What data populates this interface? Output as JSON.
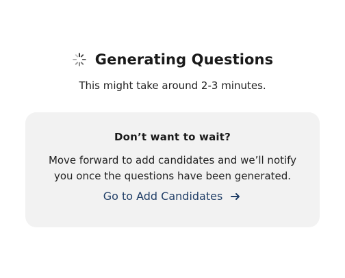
{
  "header": {
    "title": "Generating Questions",
    "subtitle": "This might take around 2-3 minutes."
  },
  "card": {
    "title": "Don’t want to wait?",
    "body": "Move forward to add candidates and we’ll notify you once the questions have been generated.",
    "link_label": "Go to Add Candidates"
  },
  "icons": {
    "loading": "loading-spinner-icon",
    "arrow": "arrow-right-icon"
  },
  "colors": {
    "card_bg": "#f2f2f2",
    "link": "#1f3d66",
    "text": "#1a1a1a"
  }
}
